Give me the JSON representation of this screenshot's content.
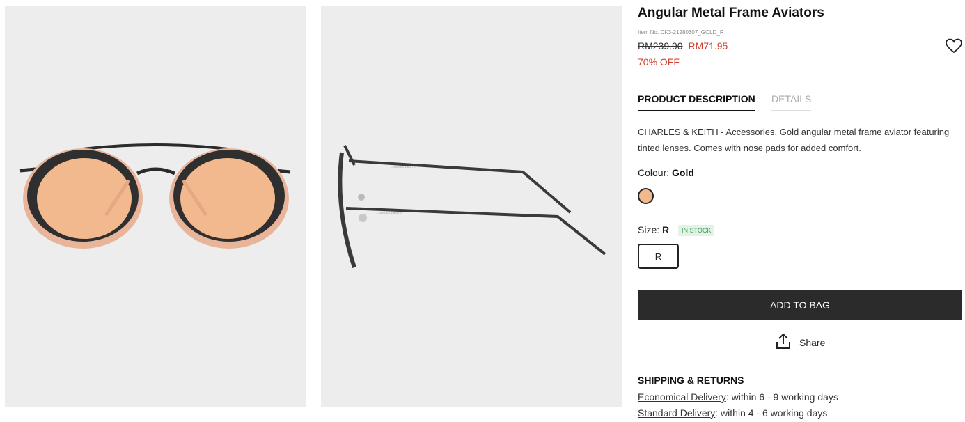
{
  "product": {
    "title": "Angular Metal Frame Aviators",
    "item_no": "Item No. CK3-21280307_GOLD_R",
    "price_original": "RM239.90",
    "price_sale": "RM71.95",
    "discount": "70% OFF"
  },
  "icons": {
    "wishlist": "heart-icon",
    "share": "share-icon"
  },
  "tabs": [
    {
      "label": "PRODUCT DESCRIPTION",
      "active": true
    },
    {
      "label": "DETAILS",
      "active": false
    }
  ],
  "description": "CHARLES & KEITH - Accessories. Gold angular metal frame aviator featuring tinted lenses. Comes with nose pads for added comfort.",
  "colour": {
    "label": "Colour:",
    "value": "Gold",
    "swatch_color": "#f1b98d"
  },
  "size": {
    "label": "Size:",
    "value": "R",
    "stock_badge": "IN STOCK",
    "options": [
      "R"
    ]
  },
  "actions": {
    "add_to_bag": "ADD TO BAG",
    "share": "Share"
  },
  "shipping": {
    "title": "SHIPPING & RETURNS",
    "lines": [
      {
        "link": "Economical Delivery",
        "text": ": within 6 - 9 working days"
      },
      {
        "link": "Standard Delivery",
        "text": ": within 4 - 6 working days"
      }
    ]
  },
  "gallery": {
    "temple_print": "CHARLES & KEITH"
  },
  "colors": {
    "accent_sale": "#d4412f",
    "button_dark": "#2b2b2b",
    "panel_bg": "#ededed",
    "stock_green": "#3a9a5a"
  }
}
